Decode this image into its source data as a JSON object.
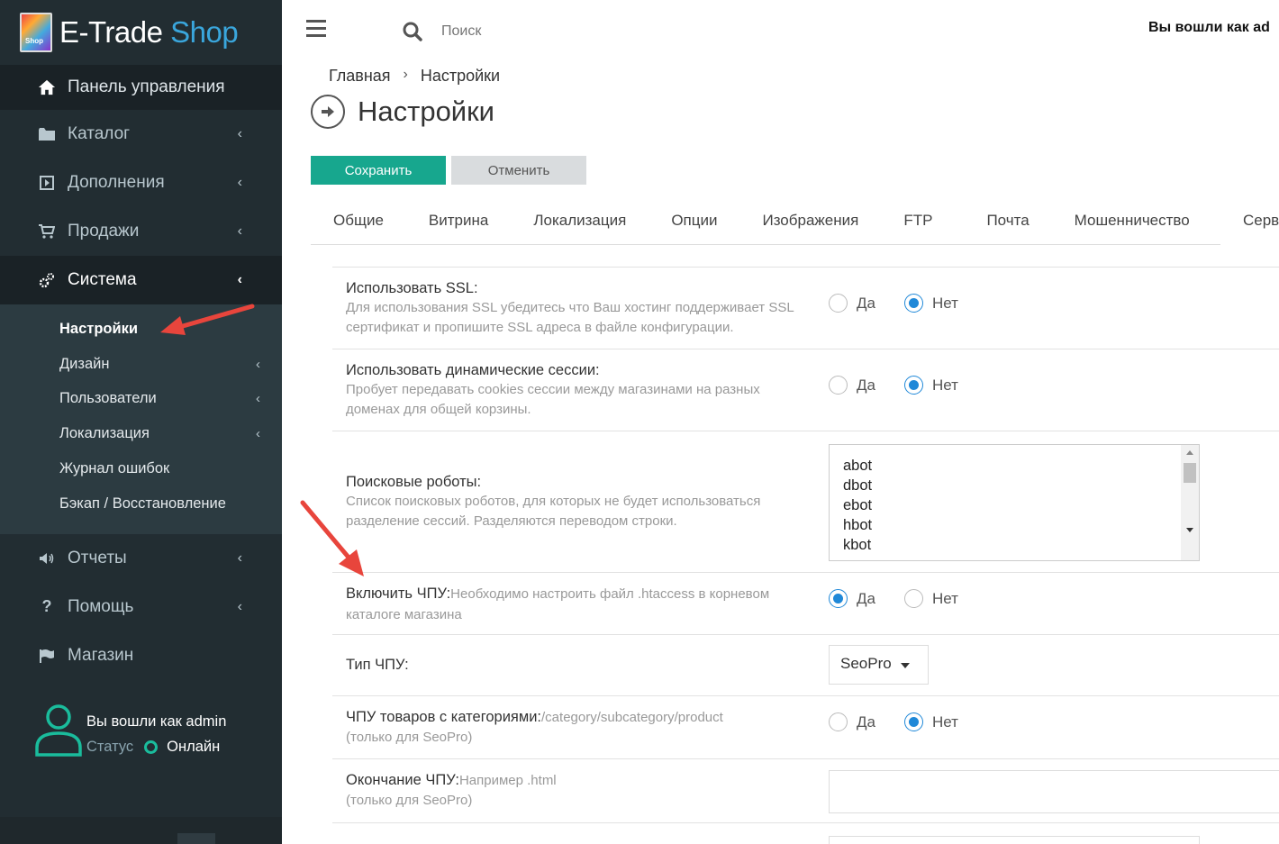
{
  "brand": {
    "name_part1": "E-Trade",
    "name_part2": "Shop",
    "box_label": "Shop"
  },
  "sidebar": {
    "menu": [
      {
        "label": "Панель управления",
        "icon": "home-icon"
      },
      {
        "label": "Каталог",
        "icon": "folder-icon"
      },
      {
        "label": "Дополнения",
        "icon": "puzzle-icon"
      },
      {
        "label": "Продажи",
        "icon": "cart-icon"
      },
      {
        "label": "Система",
        "icon": "cogs-icon"
      }
    ],
    "submenu": [
      {
        "label": "Настройки"
      },
      {
        "label": "Дизайн"
      },
      {
        "label": "Пользователи"
      },
      {
        "label": "Локализация"
      },
      {
        "label": "Журнал ошибок"
      },
      {
        "label": "Бэкап / Восстановление"
      }
    ],
    "menu2": [
      {
        "label": "Отчеты",
        "icon": "volume-icon"
      },
      {
        "label": "Помощь",
        "icon": "question-icon"
      },
      {
        "label": "Магазин",
        "icon": "flag-icon"
      }
    ],
    "user": {
      "name": "Вы вошли как admin",
      "status_label": "Статус",
      "status_value": "Онлайн"
    }
  },
  "header": {
    "search_placeholder": "Поиск",
    "logged_in_as": "Вы вошли как ad"
  },
  "breadcrumb": {
    "home": "Главная",
    "sep": "›",
    "current": "Настройки"
  },
  "page": {
    "title": "Настройки"
  },
  "buttons": {
    "save": "Сохранить",
    "cancel": "Отменить"
  },
  "tabs": [
    "Общие",
    "Витрина",
    "Локализация",
    "Опции",
    "Изображения",
    "FTP",
    "Почта",
    "Мошенничество",
    "Серв"
  ],
  "settings": {
    "ssl": {
      "label": "Использовать SSL:",
      "help": "Для использования SSL убедитесь что Ваш хостинг поддерживает SSL сертификат и пропишите SSL адреса в файле конфигурации.",
      "yes": "Да",
      "no": "Нет",
      "value": "no"
    },
    "sessions": {
      "label": "Использовать динамические сессии:",
      "help": "Пробует передавать cookies сессии между магазинами на разных доменах для общей корзины.",
      "yes": "Да",
      "no": "Нет",
      "value": "no"
    },
    "robots": {
      "label": "Поисковые роботы:",
      "help": "Список поисковых роботов, для которых не будет использоваться разделение сессий. Разделяются переводом строки.",
      "lines": [
        "abot",
        "dbot",
        "ebot",
        "hbot",
        "kbot"
      ]
    },
    "seo_url": {
      "label": "Включить ЧПУ:",
      "help": "Необходимо настроить файл .htaccess в корневом каталоге магазина",
      "yes": "Да",
      "no": "Нет",
      "value": "yes"
    },
    "seo_type": {
      "label": "Тип ЧПУ:",
      "selected": "SeoPro"
    },
    "seo_cat": {
      "label": "ЧПУ товаров с категориями:",
      "help": "/category/subcategory/product",
      "help2": "(только для SeoPro)",
      "yes": "Да",
      "no": "Нет",
      "value": "no"
    },
    "seo_ext": {
      "label": "Окончание ЧПУ:",
      "help": "Например .html",
      "help2": "(только для SeoPro)",
      "value": ""
    }
  },
  "colors": {
    "sidebar_bg": "#222d32",
    "accent": "#17a78e",
    "radio_on": "#1f88d8",
    "arrow": "#e8453c",
    "brand_blue": "#3aa6dc"
  }
}
